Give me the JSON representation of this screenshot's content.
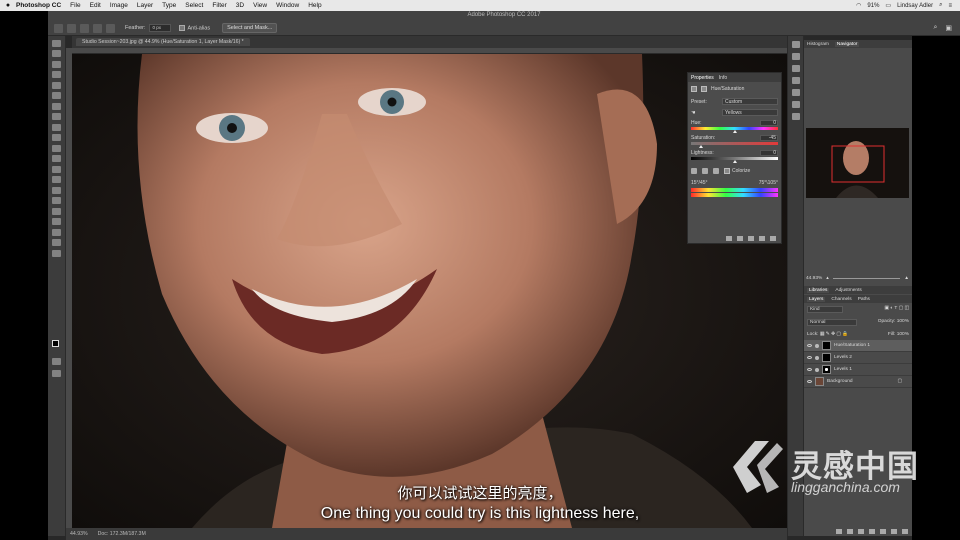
{
  "menubar": {
    "app_name": "Photoshop CC",
    "items": [
      "File",
      "Edit",
      "Image",
      "Layer",
      "Type",
      "Select",
      "Filter",
      "3D",
      "View",
      "Window",
      "Help"
    ],
    "battery": "91%",
    "clock": "Lindsay Adler"
  },
  "window_title": "Adobe Photoshop CC 2017",
  "options_bar": {
    "feather_label": "Feather:",
    "feather_value": "0 px",
    "anti_alias": "Anti-alias",
    "select_mask": "Select and Mask..."
  },
  "document_tab": "Studio Session~203.jpg @ 44.9% (Hue/Saturation 1, Layer Mask/16) *",
  "status": {
    "zoom": "44.93%",
    "doc": "Doc: 172.3M/187.3M"
  },
  "properties": {
    "tabs": [
      "Properties",
      "Info"
    ],
    "title": "Hue/Saturation",
    "preset_label": "Preset:",
    "preset_value": "Custom",
    "channel_value": "Yellows",
    "hue_label": "Hue:",
    "hue_value": "0",
    "saturation_label": "Saturation:",
    "saturation_value": "-45",
    "lightness_label": "Lightness:",
    "lightness_value": "0",
    "colorize": "Colorize",
    "range_left": "15°/45°",
    "range_right": "75°\\105°"
  },
  "navigator": {
    "tabs": [
      "Histogram",
      "Navigator"
    ],
    "zoom": "44.93%"
  },
  "libraries": {
    "tabs": [
      "Libraries",
      "Adjustments"
    ]
  },
  "layers": {
    "tabs": [
      "Layers",
      "Channels",
      "Paths"
    ],
    "kind": "Kind",
    "blend": "Normal",
    "opacity_label": "Opacity:",
    "opacity_value": "100%",
    "lock_label": "Lock:",
    "fill_label": "Fill:",
    "fill_value": "100%",
    "rows": [
      "Hue/Saturation 1",
      "Levels 2",
      "Levels 1",
      "Background"
    ]
  },
  "subtitles": {
    "cn": "你可以试试这里的亮度，",
    "en": "One thing you could try is this lightness here,"
  },
  "watermark": {
    "name": "灵感中国",
    "url": "lingganchina.com"
  }
}
